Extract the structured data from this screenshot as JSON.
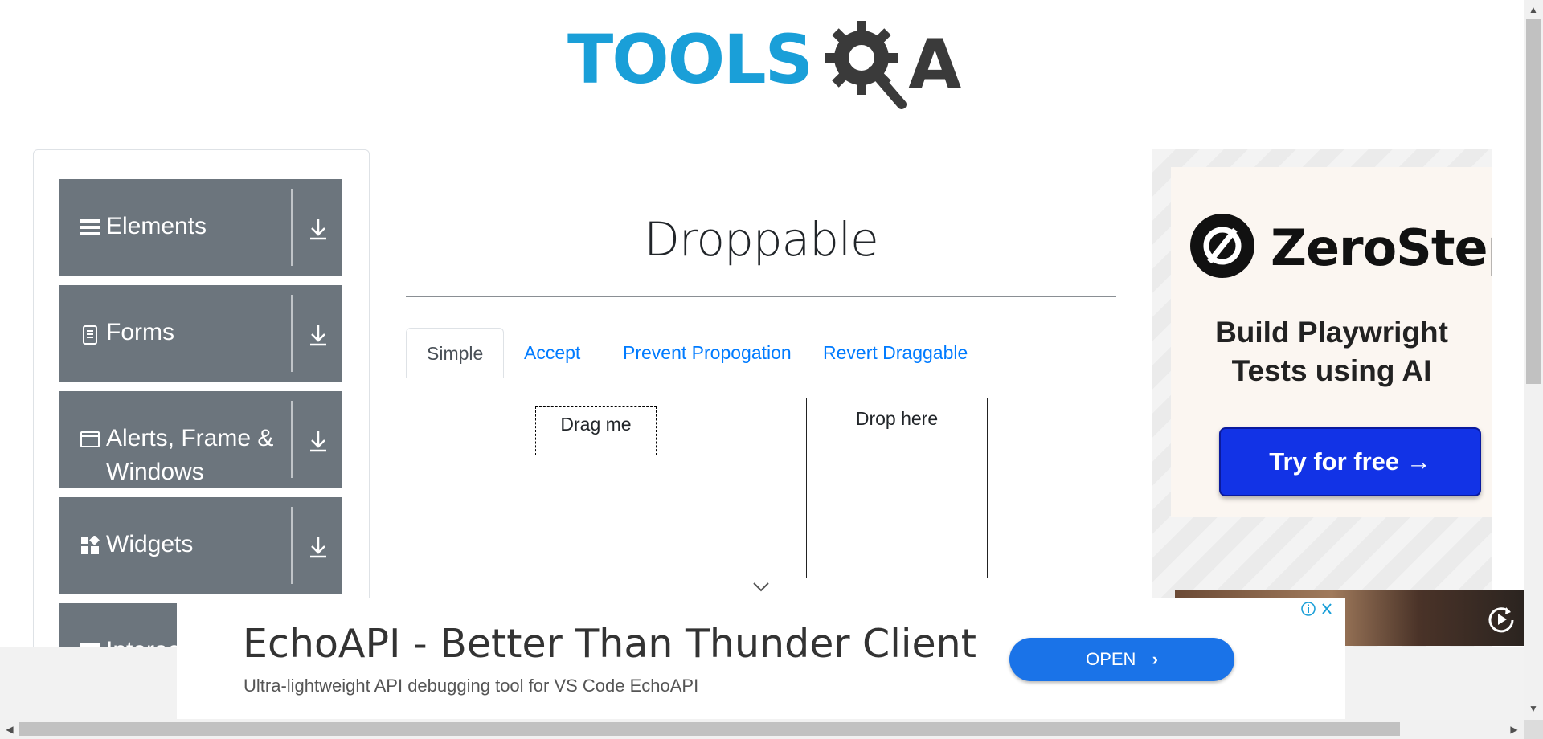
{
  "header": {
    "logo_text": "TOOLS",
    "logo_suffix": "A"
  },
  "sidebar": {
    "groups": [
      {
        "label": "Elements",
        "icon": "hamburger-icon"
      },
      {
        "label": "Forms",
        "icon": "document-icon"
      },
      {
        "label": "Alerts, Frame &",
        "label2": "Windows",
        "icon": "window-icon"
      },
      {
        "label": "Widgets",
        "icon": "widgets-icon"
      },
      {
        "label": "Interactions",
        "icon": "hamburger-icon"
      }
    ]
  },
  "main": {
    "title": "Droppable",
    "tabs": [
      {
        "label": "Simple",
        "active": true
      },
      {
        "label": "Accept",
        "active": false
      },
      {
        "label": "Prevent Propogation",
        "active": false
      },
      {
        "label": "Revert Draggable",
        "active": false
      }
    ],
    "drag_label": "Drag me",
    "drop_label": "Drop here"
  },
  "ad_right": {
    "brand": "ZeroStep",
    "tagline_line1": "Build Playwright",
    "tagline_line2": "Tests using AI",
    "cta": "Try for free →"
  },
  "ad_bottom": {
    "headline": "EchoAPI - Better Than Thunder Client",
    "description": "Ultra-lightweight API debugging tool for VS Code EchoAPI",
    "cta": "OPEN"
  },
  "colors": {
    "brand_blue": "#1a9fd8",
    "sidebar_bg": "#6c757d",
    "link": "#007bff",
    "cta_blue": "#1233e6",
    "open_btn": "#1a73e8"
  }
}
